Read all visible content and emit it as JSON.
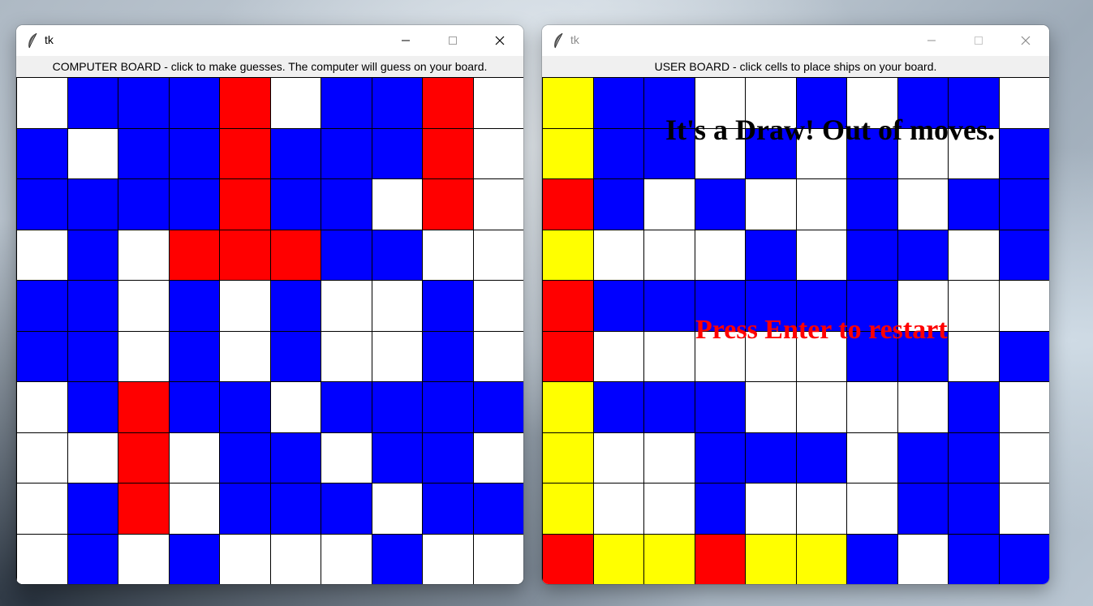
{
  "colors": {
    "hit": "#ff0000",
    "miss": "#0000ff",
    "empty": "#ffffff",
    "ship": "#ffff00",
    "message_text": "#000000",
    "restart_text": "#ff0000"
  },
  "computer_window": {
    "title": "tk",
    "board_label": "COMPUTER BOARD - click to make guesses. The computer will guess on your board.",
    "grid": [
      [
        "white",
        "blue",
        "blue",
        "blue",
        "red",
        "white",
        "blue",
        "blue",
        "red",
        "white"
      ],
      [
        "blue",
        "white",
        "blue",
        "blue",
        "red",
        "blue",
        "blue",
        "blue",
        "red",
        "white"
      ],
      [
        "blue",
        "blue",
        "blue",
        "blue",
        "red",
        "blue",
        "blue",
        "white",
        "red",
        "white"
      ],
      [
        "white",
        "blue",
        "white",
        "red",
        "red",
        "red",
        "blue",
        "blue",
        "white",
        "white"
      ],
      [
        "blue",
        "blue",
        "white",
        "blue",
        "white",
        "blue",
        "white",
        "white",
        "blue",
        "white"
      ],
      [
        "blue",
        "blue",
        "white",
        "blue",
        "white",
        "blue",
        "white",
        "white",
        "blue",
        "white"
      ],
      [
        "white",
        "blue",
        "red",
        "blue",
        "blue",
        "white",
        "blue",
        "blue",
        "blue",
        "blue"
      ],
      [
        "white",
        "white",
        "red",
        "white",
        "blue",
        "blue",
        "white",
        "blue",
        "blue",
        "white"
      ],
      [
        "white",
        "blue",
        "red",
        "white",
        "blue",
        "blue",
        "blue",
        "white",
        "blue",
        "blue"
      ],
      [
        "white",
        "blue",
        "white",
        "blue",
        "white",
        "white",
        "white",
        "blue",
        "white",
        "white"
      ]
    ]
  },
  "user_window": {
    "title": "tk",
    "board_label": "USER BOARD - click cells to place ships on your board.",
    "grid": [
      [
        "yellow",
        "blue",
        "blue",
        "white",
        "white",
        "blue",
        "white",
        "blue",
        "blue",
        "white"
      ],
      [
        "yellow",
        "blue",
        "blue",
        "white",
        "blue",
        "white",
        "blue",
        "white",
        "white",
        "blue"
      ],
      [
        "red",
        "blue",
        "white",
        "blue",
        "white",
        "white",
        "blue",
        "white",
        "blue",
        "blue"
      ],
      [
        "yellow",
        "white",
        "white",
        "white",
        "blue",
        "white",
        "blue",
        "blue",
        "white",
        "blue"
      ],
      [
        "red",
        "blue",
        "blue",
        "blue",
        "blue",
        "blue",
        "blue",
        "white",
        "white",
        "white"
      ],
      [
        "red",
        "white",
        "white",
        "white",
        "white",
        "white",
        "blue",
        "blue",
        "white",
        "blue"
      ],
      [
        "yellow",
        "blue",
        "blue",
        "blue",
        "white",
        "white",
        "white",
        "white",
        "blue",
        "white"
      ],
      [
        "yellow",
        "white",
        "white",
        "blue",
        "blue",
        "blue",
        "white",
        "blue",
        "blue",
        "white"
      ],
      [
        "yellow",
        "white",
        "white",
        "blue",
        "white",
        "white",
        "white",
        "blue",
        "blue",
        "white"
      ],
      [
        "red",
        "yellow",
        "yellow",
        "red",
        "yellow",
        "yellow",
        "blue",
        "white",
        "blue",
        "blue"
      ]
    ],
    "result_message": "It's a Draw! Out of moves.",
    "restart_message": "Press Enter to restart"
  }
}
